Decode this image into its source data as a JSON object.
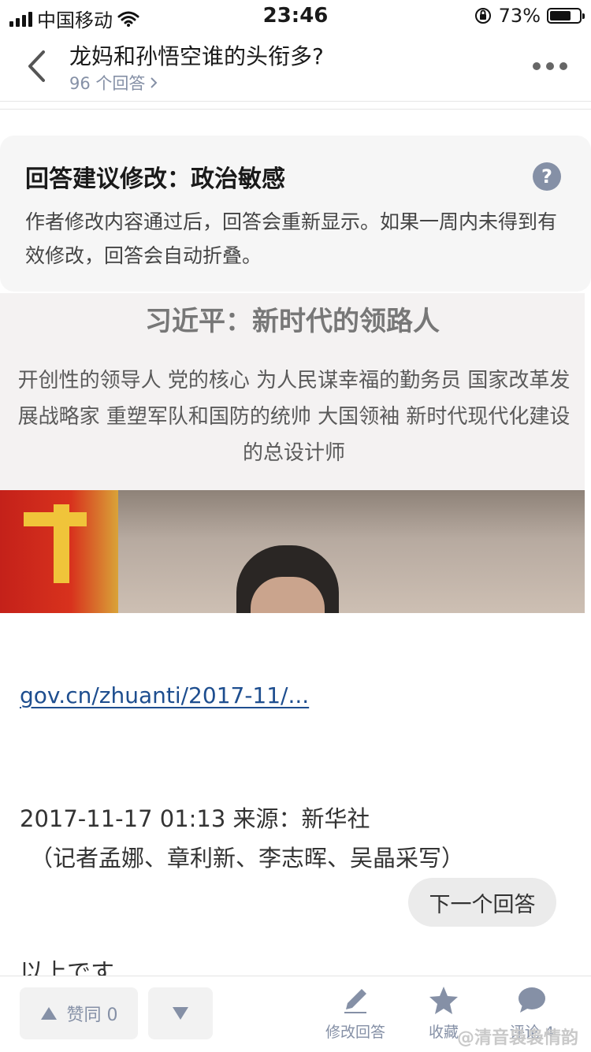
{
  "status_bar": {
    "carrier": "中国移动",
    "time": "23:46",
    "battery": "73%",
    "battery_level": 0.73
  },
  "nav": {
    "title": "龙妈和孙悟空谁的头衔多?",
    "answer_count": "96 个回答"
  },
  "warning": {
    "title": "回答建议修改：政治敏感",
    "body": "作者修改内容通过后，回答会重新显示。如果一周内未得到有效修改，回答会自动折叠。",
    "help_icon_label": "?"
  },
  "image": {
    "headline": "习近平：新时代的领路人",
    "titles": "开创性的领导人 党的核心 为人民谋幸福的勤务员 国家改革发展战略家 重塑军队和国防的统帅 大国领袖 新时代现代化建设的总设计师"
  },
  "content": {
    "link": "gov.cn/zhuanti/2017-11/...",
    "meta_line1": "2017-11-17 01:13 来源：新华社",
    "meta_line2": "（记者孟娜、章利新、李志晖、吴晶采写）",
    "next_answer": "下一个回答",
    "cutoff_text": "以上です"
  },
  "bottom_bar": {
    "upvote": "赞同 0",
    "edit": "修改回答",
    "favorite": "收藏",
    "comment": "评论 4",
    "watermark": "@清音袅袅情韵"
  },
  "colors": {
    "accent": "#1e4e8f",
    "muted": "#8590a6",
    "card_bg": "#f6f6f6"
  }
}
